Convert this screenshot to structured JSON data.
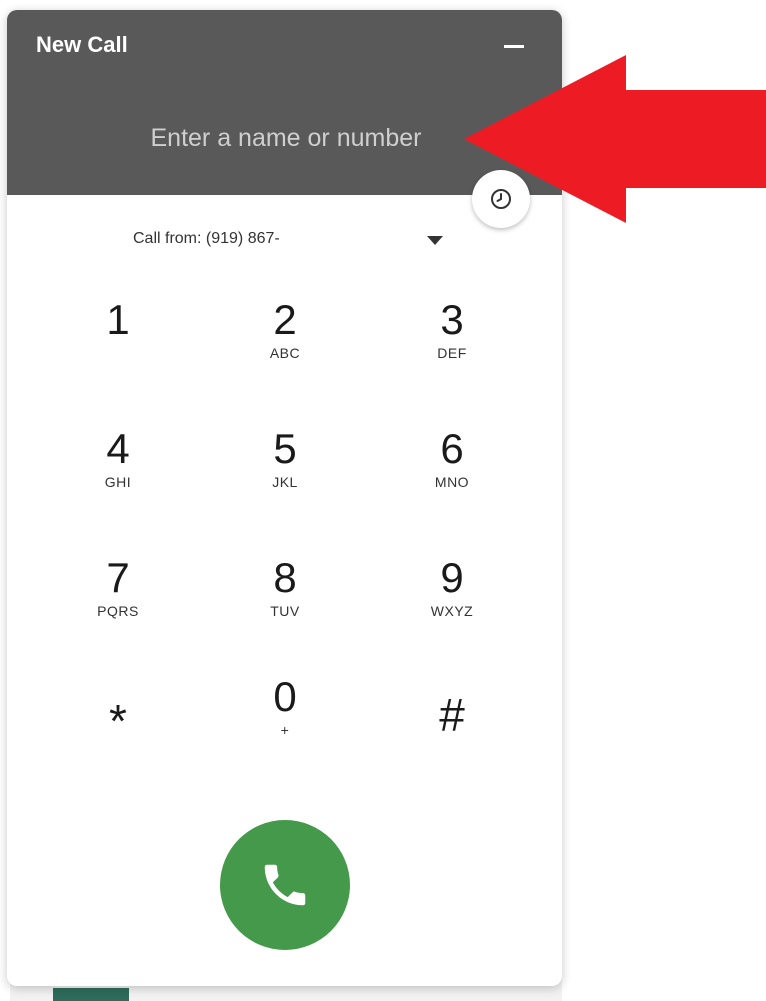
{
  "dialer": {
    "title": "New Call",
    "search_placeholder": "Enter a name or number",
    "call_from_label": "Call from: (919) 867-",
    "keys": [
      {
        "digit": "1",
        "letters": ""
      },
      {
        "digit": "2",
        "letters": "ABC"
      },
      {
        "digit": "3",
        "letters": "DEF"
      },
      {
        "digit": "4",
        "letters": "GHI"
      },
      {
        "digit": "5",
        "letters": "JKL"
      },
      {
        "digit": "6",
        "letters": "MNO"
      },
      {
        "digit": "7",
        "letters": "PQRS"
      },
      {
        "digit": "8",
        "letters": "TUV"
      },
      {
        "digit": "9",
        "letters": "WXYZ"
      },
      {
        "digit": "*",
        "letters": ""
      },
      {
        "digit": "0",
        "letters": "+"
      },
      {
        "digit": "#",
        "letters": ""
      }
    ]
  },
  "icons": {
    "minimize": "minimize-icon",
    "history": "clock-history-icon",
    "call_from_dropdown": "caret-down-icon",
    "call": "phone-icon",
    "annotation": "red-arrow-icon"
  },
  "colors": {
    "header_bg": "#595959",
    "call_button": "#45994a",
    "annotation_arrow": "#ed1c24"
  }
}
